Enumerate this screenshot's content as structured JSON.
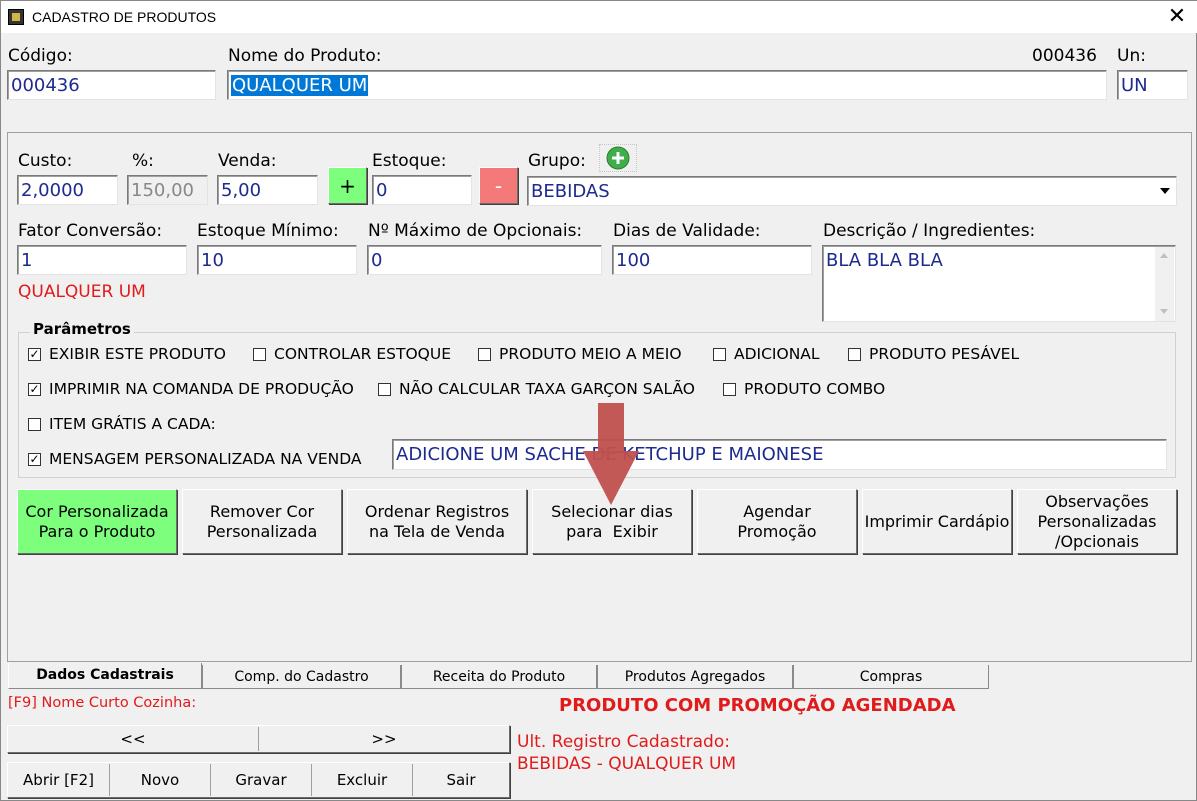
{
  "window": {
    "title": "CADASTRO DE PRODUTOS"
  },
  "header": {
    "codigo_label": "Código:",
    "codigo_value": "000436",
    "nome_label": "Nome do Produto:",
    "nome_value": "QUALQUER UM",
    "code_display": "000436",
    "un_label": "Un:",
    "un_value": "UN"
  },
  "form": {
    "custo_label": "Custo:",
    "custo_value": "2,0000",
    "percent_label": "%:",
    "percent_value": "150,00",
    "venda_label": "Venda:",
    "venda_value": "5,00",
    "plus_label": "+",
    "estoque_label": "Estoque:",
    "estoque_value": "0",
    "minus_label": "-",
    "grupo_label": "Grupo:",
    "grupo_value": "BEBIDAS",
    "fator_label": "Fator Conversão:",
    "fator_value": "1",
    "estoque_min_label": "Estoque Mínimo:",
    "estoque_min_value": "10",
    "max_opc_label": "Nº Máximo de Opcionais:",
    "max_opc_value": "0",
    "dias_label": "Dias de Validade:",
    "dias_value": "100",
    "desc_label": "Descrição / Ingredientes:",
    "desc_value": "BLA BLA BLA",
    "conversion_note": "QUALQUER UM"
  },
  "parametros": {
    "title": "Parâmetros",
    "items": [
      {
        "label": "EXIBIR ESTE PRODUTO",
        "checked": true
      },
      {
        "label": "CONTROLAR ESTOQUE",
        "checked": false
      },
      {
        "label": "PRODUTO MEIO A MEIO",
        "checked": false
      },
      {
        "label": "ADICIONAL",
        "checked": false
      },
      {
        "label": "PRODUTO PESÁVEL",
        "checked": false
      },
      {
        "label": "IMPRIMIR NA COMANDA DE PRODUÇÃO",
        "checked": true
      },
      {
        "label": "NÃO CALCULAR TAXA GARÇON SALÃO",
        "checked": false
      },
      {
        "label": "PRODUTO COMBO",
        "checked": false
      },
      {
        "label": "ITEM GRÁTIS A CADA:",
        "checked": false
      },
      {
        "label": "MENSAGEM PERSONALIZADA NA VENDA",
        "checked": true
      }
    ],
    "mensagem_value": "ADICIONE UM SACHE DE KETCHUP E MAIONESE"
  },
  "actions": {
    "cor_line1": "Cor Personalizada",
    "cor_line2": "Para o Produto",
    "remover_line1": "Remover Cor",
    "remover_line2": "Personalizada",
    "ordenar_line1": "Ordenar Registros",
    "ordenar_line2": "na Tela de Venda",
    "selecionar_line1": "Selecionar dias",
    "selecionar_line2": "para  Exibir",
    "agendar_line1": "Agendar",
    "agendar_line2": "Promoção",
    "imprimir": "Imprimir Cardápio",
    "obs_line1": "Observações",
    "obs_line2": "Personalizadas",
    "obs_line3": "/Opcionais"
  },
  "tabs": [
    "Dados Cadastrais",
    "Comp. do Cadastro",
    "Receita do Produto",
    "Produtos Agregados",
    "Compras"
  ],
  "footer": {
    "f9_note": "[F9] Nome Curto Cozinha:",
    "promo_note": "PRODUTO COM PROMOÇÃO AGENDADA",
    "prev": "<<",
    "next": ">>",
    "ult_label": "Ult. Registro Cadastrado:",
    "ult_value": "BEBIDAS - QUALQUER UM",
    "abrir": "Abrir [F2]",
    "novo": "Novo",
    "gravar": "Gravar",
    "excluir": "Excluir",
    "sair": "Sair"
  },
  "colors": {
    "accent_green": "#7dff7d",
    "minus_red": "#f47a7a",
    "alert_red": "#e01b1b",
    "value_blue": "#1d2a8f"
  },
  "icons": [
    "app-icon",
    "close-icon",
    "add-group-icon",
    "dropdown-arrow-icon",
    "down-arrow-overlay-icon"
  ]
}
